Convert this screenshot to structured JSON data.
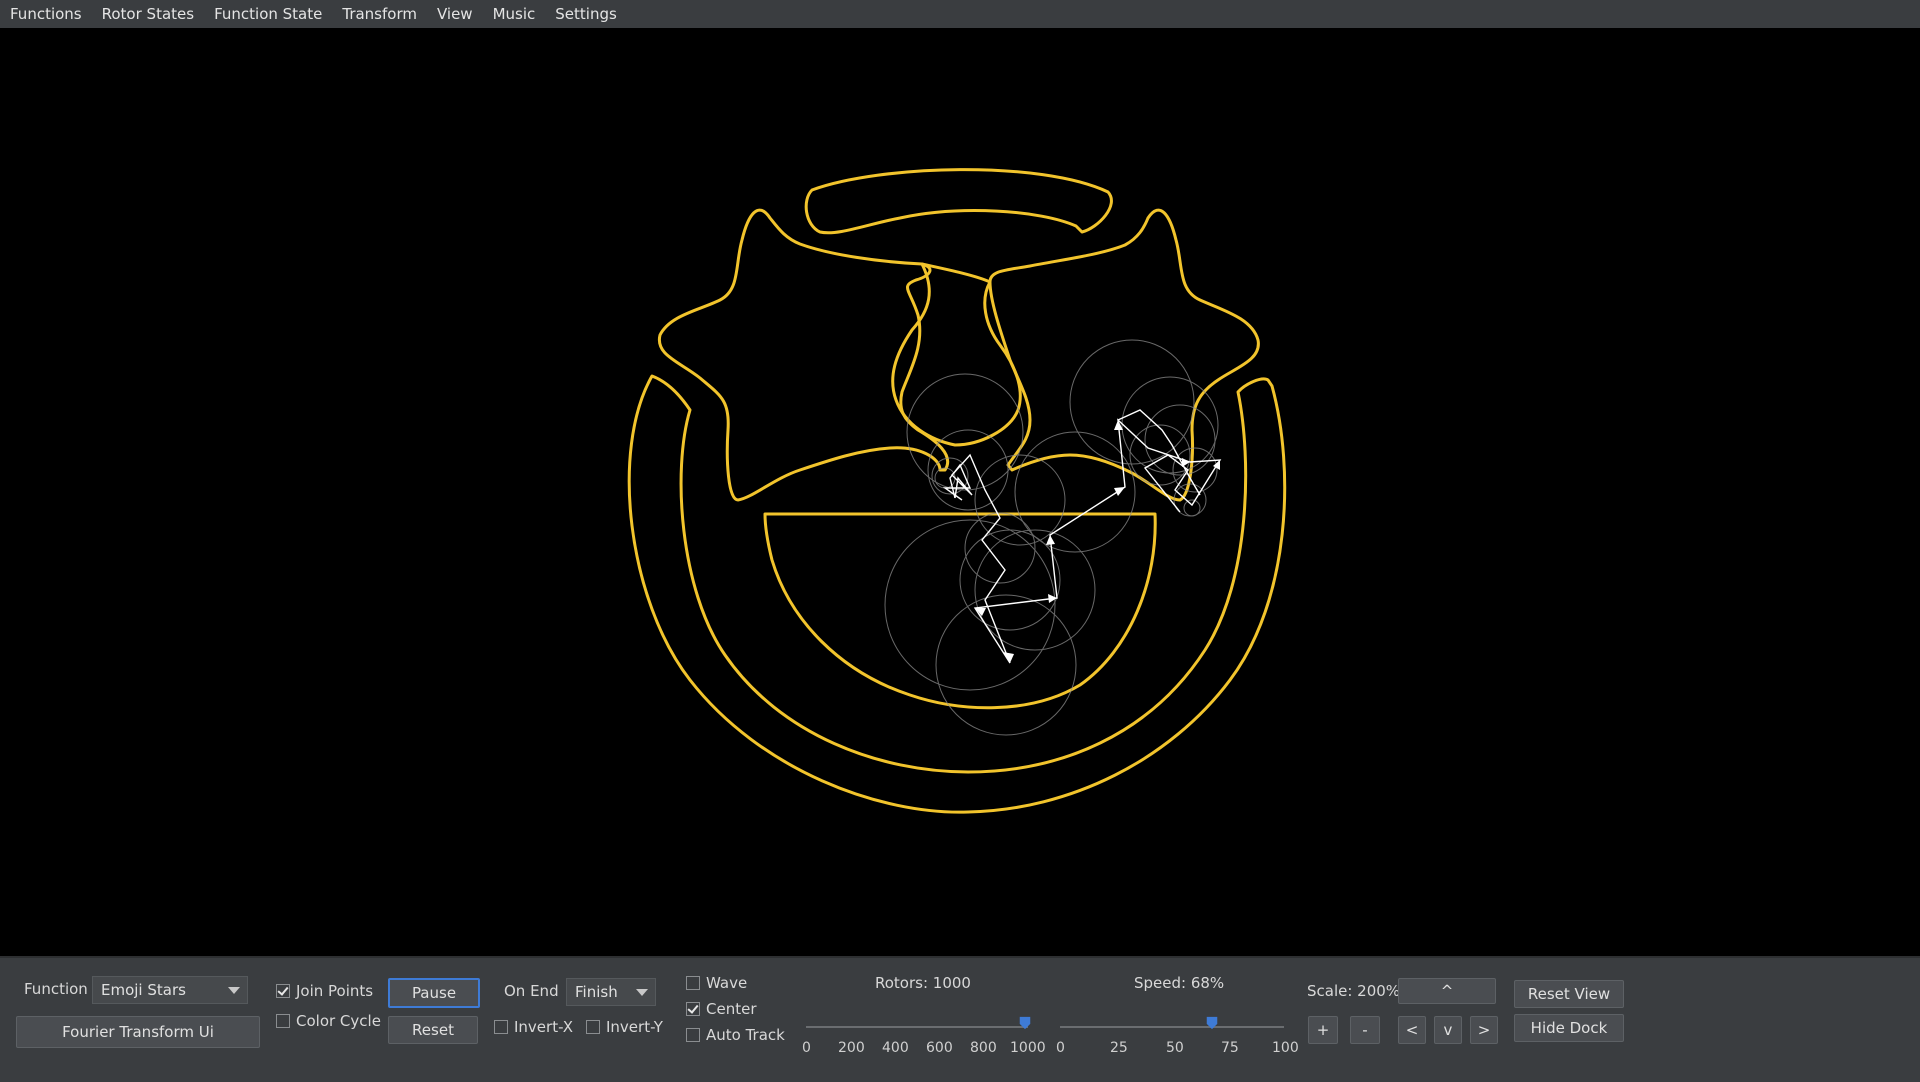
{
  "menu": [
    "Functions",
    "Rotor States",
    "Function State",
    "Transform",
    "View",
    "Music",
    "Settings"
  ],
  "dock": {
    "function_label": "Function",
    "function_value": "Emoji Stars",
    "fourier_button": "Fourier Transform Ui",
    "join_points": {
      "label": "Join Points",
      "checked": true
    },
    "color_cycle": {
      "label": "Color Cycle",
      "checked": false
    },
    "pause_button": "Pause",
    "reset_button": "Reset",
    "on_end_label": "On End",
    "on_end_value": "Finish",
    "invert_x": {
      "label": "Invert-X",
      "checked": false
    },
    "invert_y": {
      "label": "Invert-Y",
      "checked": false
    },
    "wave": {
      "label": "Wave",
      "checked": false
    },
    "center": {
      "label": "Center",
      "checked": true
    },
    "auto_track": {
      "label": "Auto Track",
      "checked": false
    },
    "rotors_label": "Rotors: 1000",
    "rotors_value": 1000,
    "rotors_max": 1000,
    "rotors_ticks": [
      "0",
      "200",
      "400",
      "600",
      "800",
      "1000"
    ],
    "speed_label": "Speed: 68%",
    "speed_value": 68,
    "speed_ticks": [
      "0",
      "25",
      "50",
      "75",
      "100"
    ],
    "scale_label": "Scale: 200%",
    "up_button": "^",
    "down_button": "v",
    "left_button": "<",
    "right_button": ">",
    "plus_button": "+",
    "minus_button": "-",
    "reset_view_button": "Reset View",
    "hide_dock_button": "Hide Dock"
  },
  "colors": {
    "trace": "#f2c42c",
    "rotor_circles": "#8c8c8c",
    "rotor_arrows": "#ffffff",
    "accent": "#3e7bd6"
  }
}
